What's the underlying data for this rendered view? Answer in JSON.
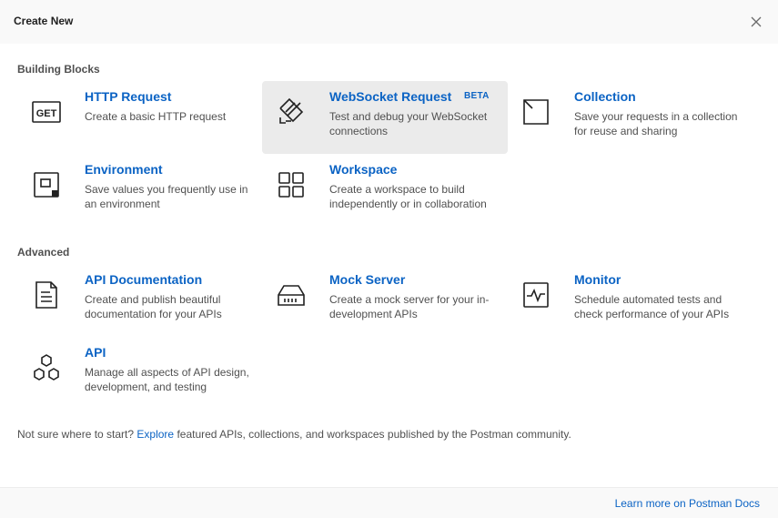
{
  "header": {
    "title": "Create New"
  },
  "sections": {
    "building_blocks": "Building Blocks",
    "advanced": "Advanced"
  },
  "cards": {
    "http_request": {
      "title": "HTTP Request",
      "desc": "Create a basic HTTP request",
      "icon": "get-icon"
    },
    "websocket_request": {
      "title": "WebSocket Request",
      "badge": "BETA",
      "desc": "Test and debug your WebSocket connections",
      "icon": "websocket-icon"
    },
    "collection": {
      "title": "Collection",
      "desc": "Save your requests in a collection for reuse and sharing",
      "icon": "collection-icon"
    },
    "environment": {
      "title": "Environment",
      "desc": "Save values you frequently use in an environment",
      "icon": "environment-icon"
    },
    "workspace": {
      "title": "Workspace",
      "desc": "Create a workspace to build independently or in collaboration",
      "icon": "grid-icon"
    },
    "api_documentation": {
      "title": "API Documentation",
      "desc": "Create and publish beautiful documentation for your APIs",
      "icon": "document-icon"
    },
    "mock_server": {
      "title": "Mock Server",
      "desc": "Create a mock server for your in-development APIs",
      "icon": "server-icon"
    },
    "monitor": {
      "title": "Monitor",
      "desc": "Schedule automated tests and check performance of your APIs",
      "icon": "pulse-icon"
    },
    "api": {
      "title": "API",
      "desc": "Manage all aspects of API design, development, and testing",
      "icon": "hexagons-icon"
    }
  },
  "footer": {
    "prefix": "Not sure where to start?",
    "link": "Explore",
    "suffix": "featured APIs, collections, and workspaces published by the Postman community.",
    "docs_link": "Learn more on Postman Docs"
  },
  "colors": {
    "accent": "#0b63c4",
    "hover_bg": "#ebebeb",
    "header_bg": "#f9f9f9"
  }
}
